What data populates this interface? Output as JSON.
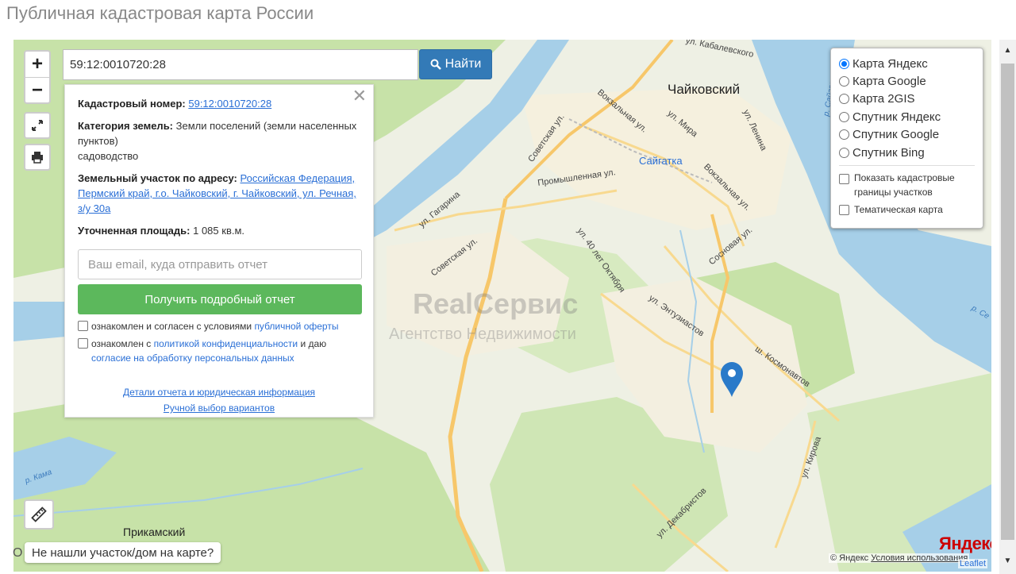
{
  "page_title": "Публичная кадастровая карта России",
  "search": {
    "value": "59:12:0010720:28",
    "button_label": "Найти"
  },
  "zoom": {
    "plus": "+",
    "minus": "−"
  },
  "info": {
    "cadastral_label": "Кадастровый номер:",
    "cadastral_value": "59:12:0010720:28",
    "category_label": "Категория земель:",
    "category_value": "Земли поселений (земли населенных пунктов)",
    "category_use": "садоводство",
    "address_label": "Земельный участок по адресу:",
    "address_value": "Российская Федерация, Пермский край, г.о. Чайковский, г. Чайковский, ул. Речная, з/у 30а",
    "area_label": "Уточненная площадь:",
    "area_value": "1 085 кв.м.",
    "email_placeholder": "Ваш email, куда отправить отчет",
    "report_button": "Получить подробный отчет",
    "agree1_text": "ознакомлен и согласен с условиями ",
    "agree1_link": "публичной оферты",
    "agree2_text": "ознакомлен с ",
    "agree2_link": "политикой конфиденциальности",
    "agree2_mid": " и даю ",
    "agree2_link2": "согласие на обработку персональных данных",
    "details_link": "Детали отчета и юридическая информация",
    "manual_link": "Ручной выбор вариантов",
    "close_symbol": "✕"
  },
  "layers": {
    "options": [
      {
        "label": "Карта Яндекс",
        "selected": true
      },
      {
        "label": "Карта Google",
        "selected": false
      },
      {
        "label": "Карта 2GIS",
        "selected": false
      },
      {
        "label": "Спутник Яндекс",
        "selected": false
      },
      {
        "label": "Спутник Google",
        "selected": false
      },
      {
        "label": "Спутник Bing",
        "selected": false
      }
    ],
    "cb_cadastral": "Показать кадастровые границы участков",
    "cb_thematic": "Тематическая карта"
  },
  "map_labels": {
    "city": "Чайковский",
    "station": "Сайгатка",
    "district": "Прикамский",
    "watermark_title": "RealСервис",
    "watermark_sub": "Агентство Недвижимости",
    "streets": [
      "ул. Кабалевского",
      "Вокзальная ул.",
      "ул. Мира",
      "ул. Ленина",
      "Советская ул.",
      "Промышленная ул.",
      "ул. Гагарина",
      "Советская ул.",
      "ул. 40 лет Октября",
      "ул. Энтузиастов",
      "Сосновая ул.",
      "Вокзальная ул.",
      "ш. Космонавтов",
      "ул. Кирова",
      "ул. Декабристов"
    ],
    "water": [
      "р. Кама",
      "р. Сайгатка",
      "р. Се"
    ]
  },
  "bottom": {
    "not_found": "Не нашли участок/дом на карте?",
    "yandex": "Яндекс",
    "copyright": "© Яндекс",
    "terms": "Условия использования",
    "leaflet": "Leaflet",
    "o_left": "О"
  },
  "colors": {
    "primary": "#337ab7",
    "success": "#5cb85c",
    "link": "#2a6fd6",
    "water": "#a6cfe8",
    "green": "#c7e2a8"
  },
  "icons": [
    "search-icon",
    "fullscreen-icon",
    "print-icon",
    "ruler-icon",
    "map-marker-icon",
    "close-icon"
  ]
}
